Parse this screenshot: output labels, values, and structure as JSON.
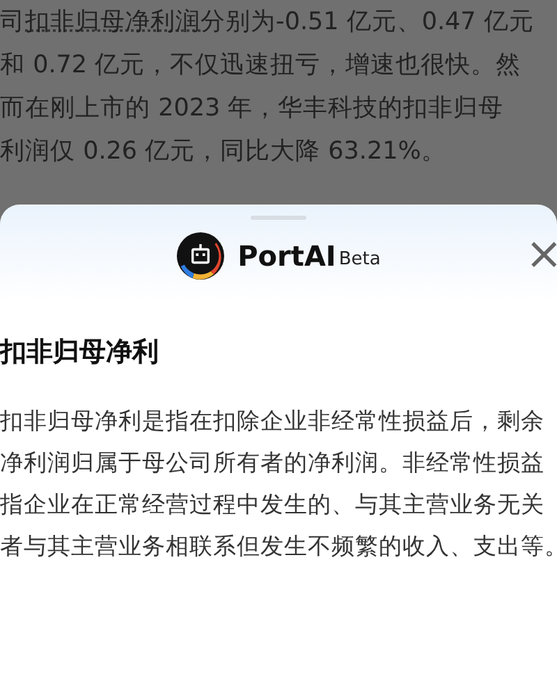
{
  "article": {
    "lines": [
      {
        "before": "司",
        "link": "扣非归母净利润",
        "after": "分别为-0.51 亿元、0.47 亿元"
      },
      {
        "before": "和 0.72 亿元，不仅迅速扭亏，增速也很快。然"
      },
      {
        "before": "而在刚上市的 2023 年，华丰科技的扣非归母"
      },
      {
        "before": "利润仅 0.26 亿元，同比大降 63.21%。"
      }
    ]
  },
  "sheet": {
    "brand": "PortAI",
    "badge": "Beta",
    "close": "×",
    "title": "扣非归母净利",
    "body": [
      "扣非归母净利是指在扣除企业非经常性损益后，剩余",
      "净利润归属于母公司所有者的净利润。非经常性损益",
      "指企业在正常经营过程中发生的、与其主营业务无关",
      "者与其主营业务相联系但发生不频繁的收入、支出等。"
    ]
  }
}
